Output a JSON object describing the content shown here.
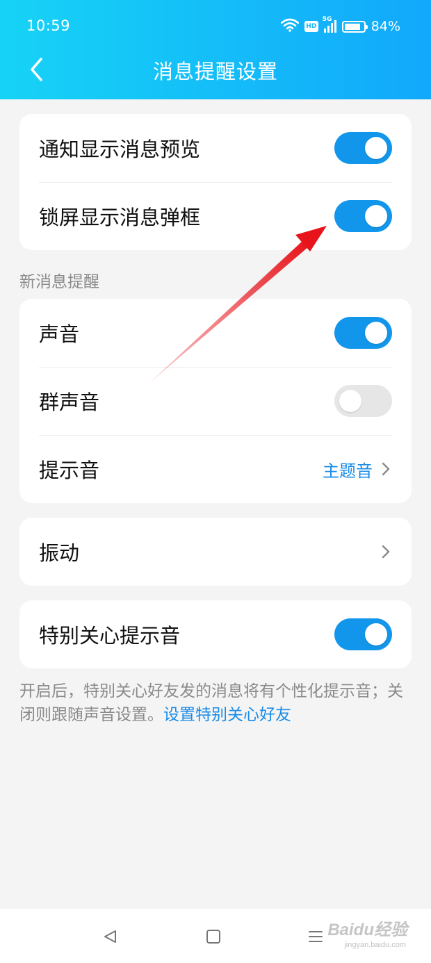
{
  "status_bar": {
    "time": "10:59",
    "network": "5G",
    "hd": "HD",
    "battery_percent": "84%",
    "battery_level": 0.84
  },
  "header": {
    "title": "消息提醒设置",
    "back_icon": "chevron-left-icon"
  },
  "group1": {
    "items": [
      {
        "label": "通知显示消息预览",
        "toggle": true
      },
      {
        "label": "锁屏显示消息弹框",
        "toggle": true
      }
    ]
  },
  "section_new_message": {
    "title": "新消息提醒",
    "items": [
      {
        "label": "声音",
        "toggle": true
      },
      {
        "label": "群声音",
        "toggle": false
      },
      {
        "label": "提示音",
        "value": "主题音"
      }
    ]
  },
  "vibration": {
    "label": "振动"
  },
  "special_care": {
    "label": "特别关心提示音",
    "toggle": true
  },
  "footnote": {
    "text": "开启后，特别关心好友发的消息将有个性化提示音；关闭则跟随声音设置。",
    "link": "设置特别关心好友"
  },
  "watermark": {
    "brand": "Baidu经验",
    "url": "jingyan.baidu.com"
  },
  "colors": {
    "header_start": "#16d3f6",
    "header_end": "#12a8fb",
    "toggle_on": "#1296eb",
    "toggle_off": "#e6e6e6",
    "link": "#1a8ce8",
    "annotation_arrow": "#e8141b"
  }
}
